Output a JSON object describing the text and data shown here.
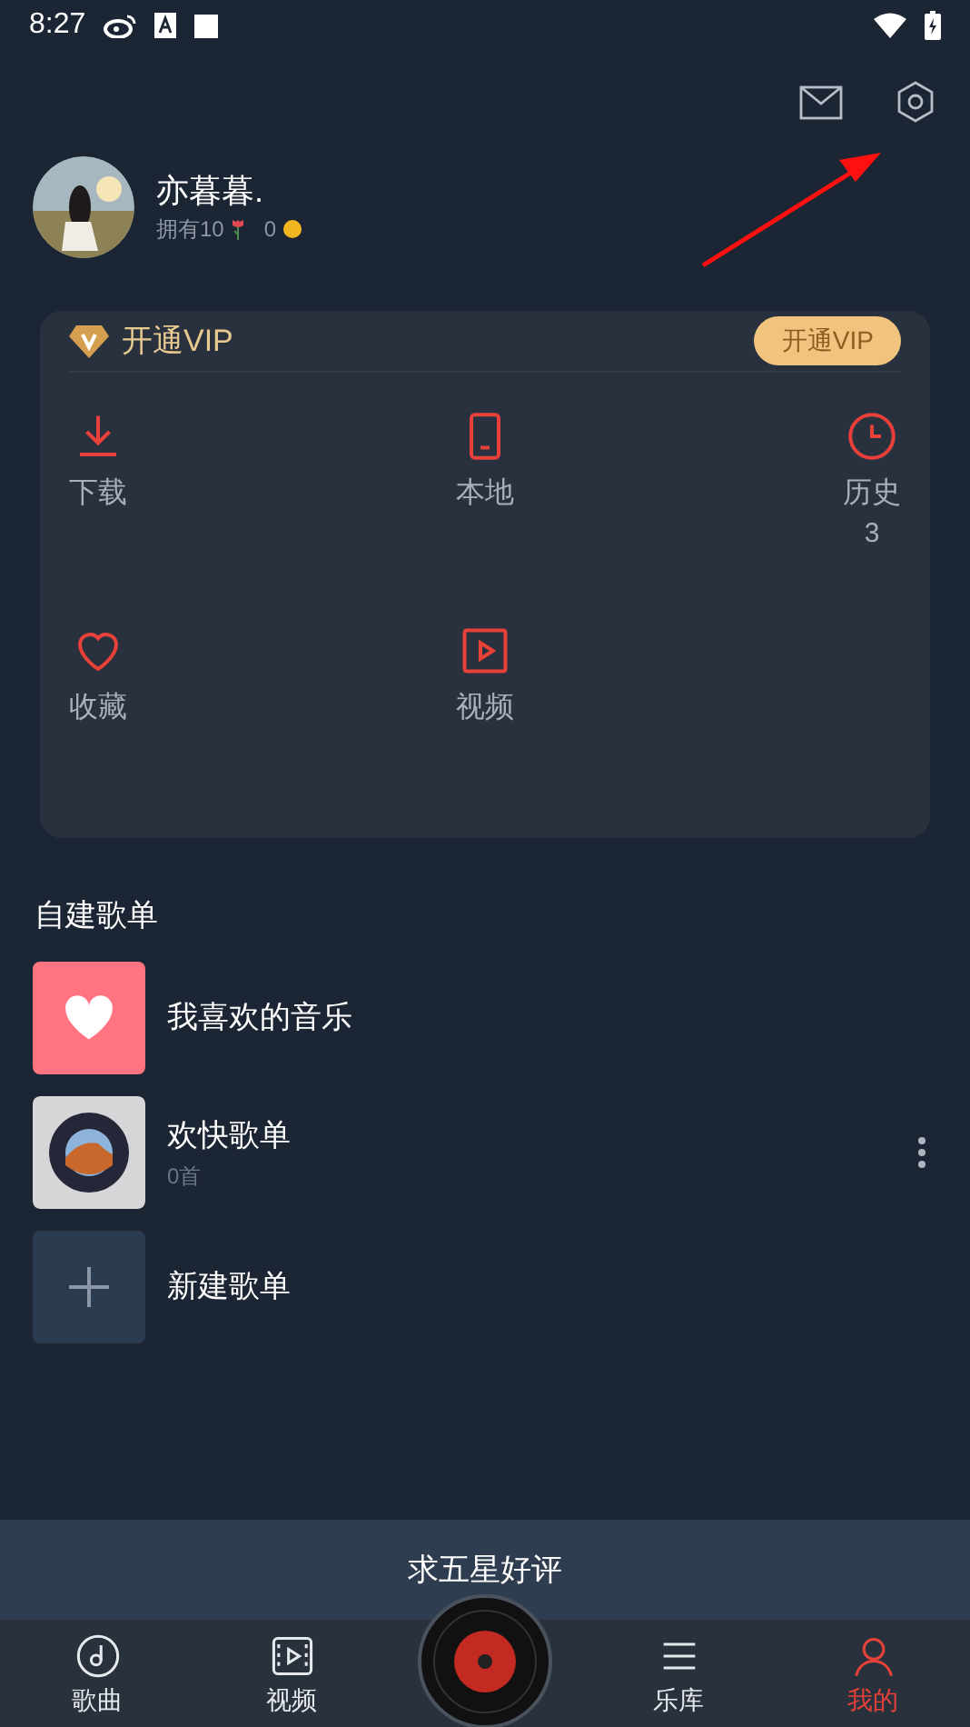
{
  "status_bar": {
    "time": "8:27"
  },
  "profile": {
    "name": "亦暮暮.",
    "owned": "拥有10",
    "coins": "0"
  },
  "vip": {
    "title": "开通VIP",
    "button": "开通VIP"
  },
  "shortcuts": [
    {
      "kind": "download",
      "label": "下载"
    },
    {
      "kind": "phone",
      "label": "本地"
    },
    {
      "kind": "clock",
      "label": "历史",
      "count": "3"
    },
    {
      "kind": "heart",
      "label": "收藏"
    },
    {
      "kind": "video",
      "label": "视频"
    }
  ],
  "playlists_title": "自建歌单",
  "playlists": [
    {
      "kind": "favorite",
      "name": "我喜欢的音乐"
    },
    {
      "kind": "cover",
      "name": "欢快歌单",
      "count": "0首"
    },
    {
      "kind": "add",
      "name": "新建歌单"
    }
  ],
  "banner": "求五星好评",
  "nav": [
    {
      "kind": "music",
      "label": "歌曲",
      "selected": false
    },
    {
      "kind": "video",
      "label": "视频",
      "selected": false
    },
    {
      "kind": "disc"
    },
    {
      "kind": "library",
      "label": "乐库",
      "selected": false
    },
    {
      "kind": "profile",
      "label": "我的",
      "selected": true
    }
  ]
}
